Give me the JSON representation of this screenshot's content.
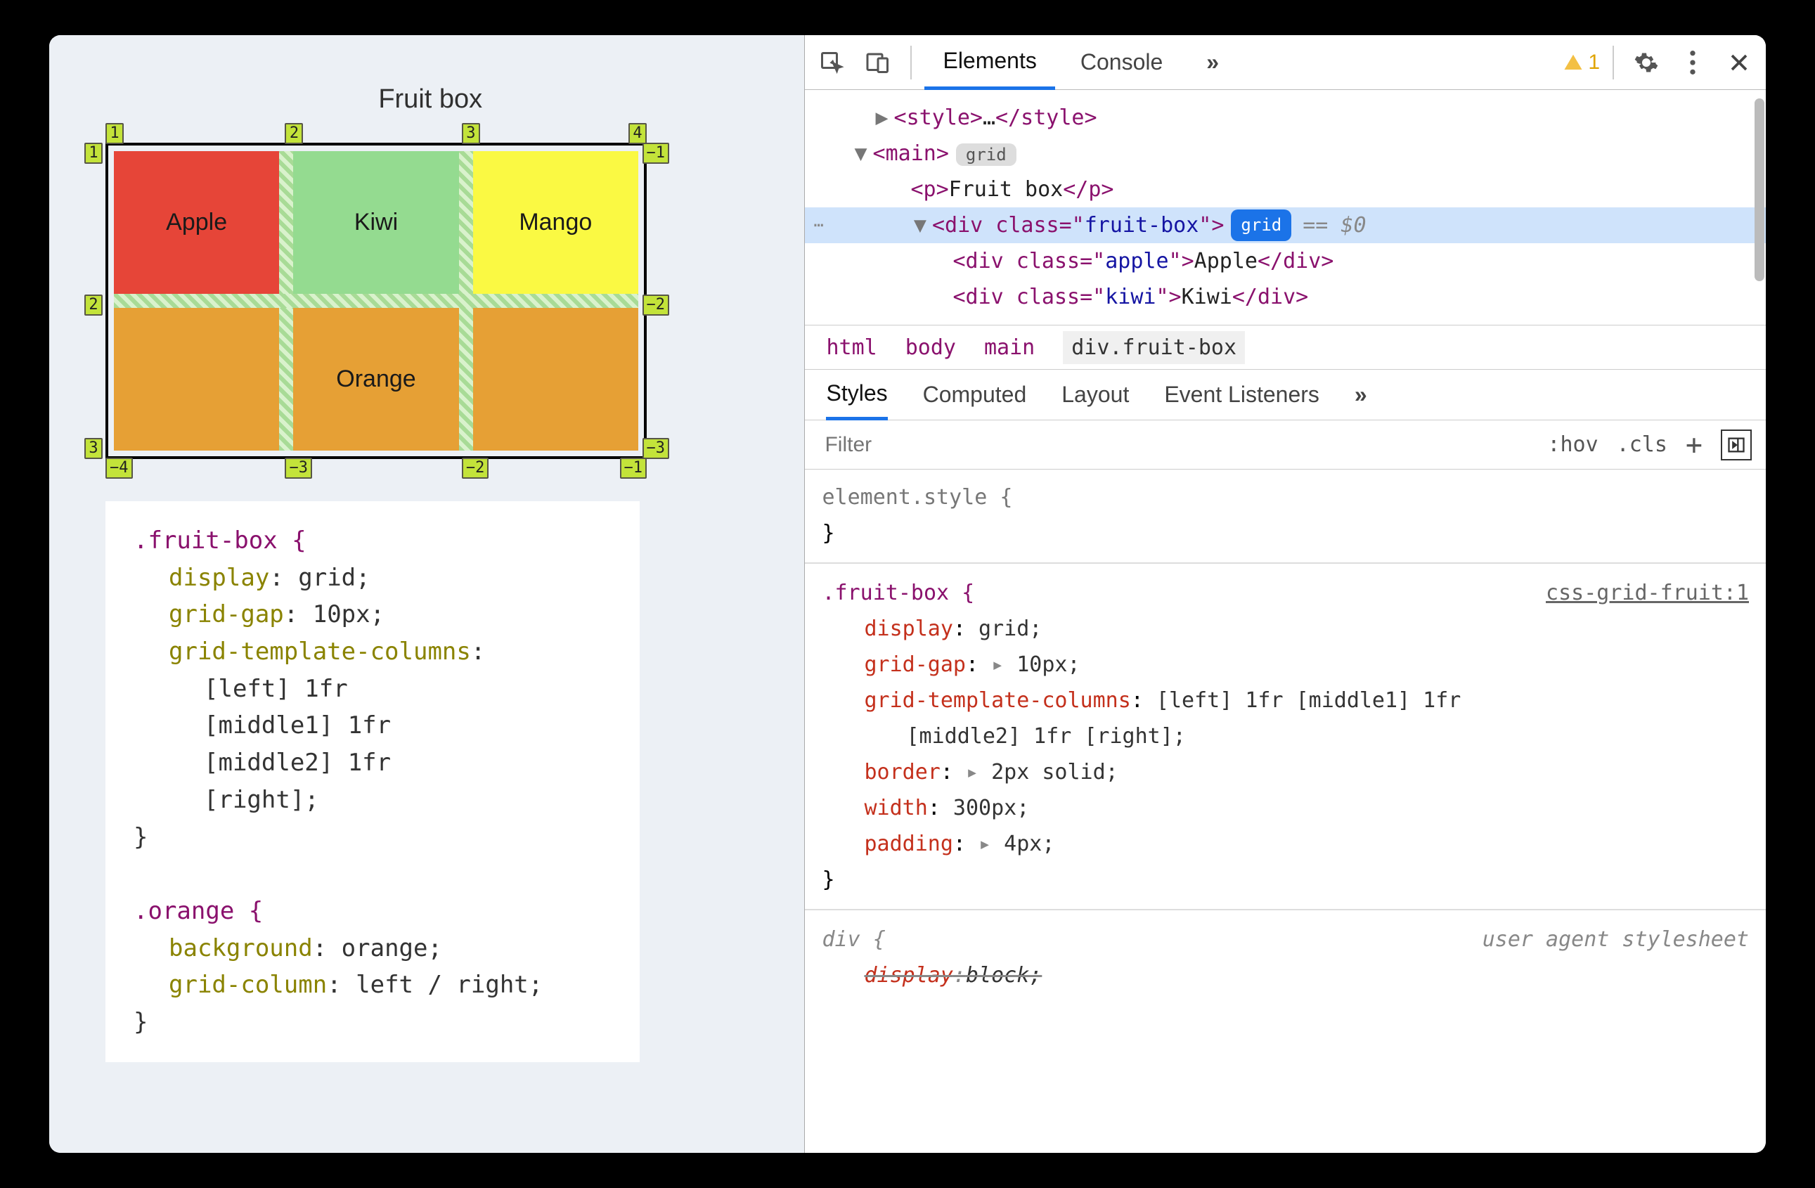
{
  "demo": {
    "title": "Fruit box",
    "cells": {
      "apple": "Apple",
      "kiwi": "Kiwi",
      "mango": "Mango",
      "orange": "Orange"
    },
    "grid_labels": {
      "top": [
        "1",
        "2",
        "3",
        "4"
      ],
      "left": [
        "1",
        "2",
        "3"
      ],
      "right": [
        "−1",
        "−2",
        "−3"
      ],
      "bottom": [
        "−4",
        "−3",
        "−2",
        "−1"
      ]
    }
  },
  "left_code": {
    "rule1": {
      "selector": ".fruit-box {",
      "display": "display",
      "display_v": "grid;",
      "gap": "grid-gap",
      "gap_v": "10px;",
      "cols": "grid-template-columns",
      "c1": "[left] 1fr",
      "c2": "[middle1] 1fr",
      "c3": "[middle2] 1fr",
      "c4": "[right];",
      "close": "}"
    },
    "rule2": {
      "selector": ".orange {",
      "bg": "background",
      "bg_v": "orange;",
      "gc": "grid-column",
      "gc_v": "left / right;",
      "close": "}"
    }
  },
  "tabs": {
    "elements": "Elements",
    "console": "Console"
  },
  "warning_count": "1",
  "dom": {
    "style": {
      "open": "<style>",
      "mid": "…",
      "close": "</style>"
    },
    "main_open": "<main>",
    "main_badge": "grid",
    "p": {
      "open": "<p>",
      "text": "Fruit box",
      "close": "</p>"
    },
    "div_fb": {
      "open": "<div class=\"",
      "cls": "fruit-box",
      "close_attr": "\">",
      "badge": "grid",
      "eq": "== $0"
    },
    "apple": {
      "open": "<div class=\"",
      "cls": "apple",
      "mid": "\">",
      "text": "Apple",
      "close": "</div>"
    },
    "kiwi": {
      "open": "<div class=\"",
      "cls": "kiwi",
      "mid": "\">",
      "text": "Kiwi",
      "close": "</div>"
    }
  },
  "breadcrumb": [
    "html",
    "body",
    "main",
    "div.fruit-box"
  ],
  "styles_tabs": [
    "Styles",
    "Computed",
    "Layout",
    "Event Listeners"
  ],
  "filter": {
    "placeholder": "Filter",
    "hov": ":hov",
    "cls": ".cls"
  },
  "styles": {
    "elstyle": "element.style {",
    "close": "}",
    "fb": {
      "sel": ".fruit-box {",
      "src": "css-grid-fruit:1",
      "display": [
        "display",
        "grid;"
      ],
      "gap": [
        "grid-gap",
        "10px;"
      ],
      "cols": [
        "grid-template-columns",
        "[left] 1fr [middle1] 1fr"
      ],
      "cols2": "[middle2] 1fr [right];",
      "border": [
        "border",
        "2px solid;"
      ],
      "width": [
        "width",
        "300px;"
      ],
      "padding": [
        "padding",
        "4px;"
      ]
    },
    "ua": {
      "sel": "div {",
      "src": "user agent stylesheet",
      "display": [
        "display",
        "block;"
      ]
    }
  }
}
